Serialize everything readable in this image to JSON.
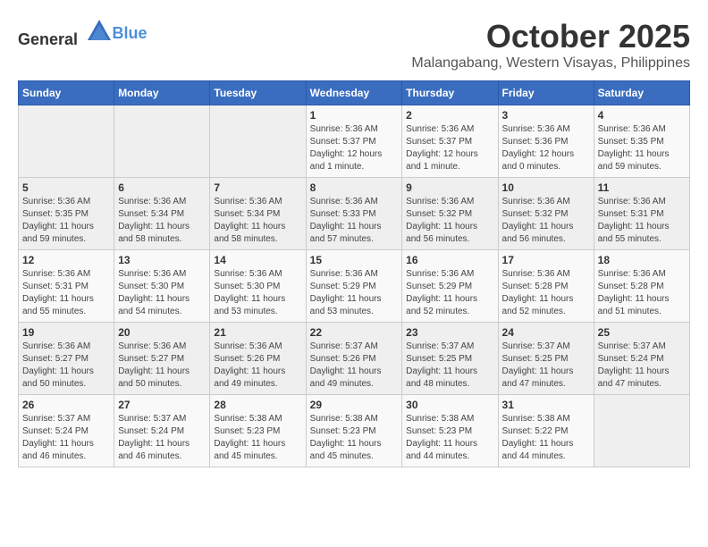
{
  "header": {
    "logo_general": "General",
    "logo_blue": "Blue",
    "month_title": "October 2025",
    "location": "Malangabang, Western Visayas, Philippines"
  },
  "weekdays": [
    "Sunday",
    "Monday",
    "Tuesday",
    "Wednesday",
    "Thursday",
    "Friday",
    "Saturday"
  ],
  "weeks": [
    [
      {
        "day": "",
        "info": ""
      },
      {
        "day": "",
        "info": ""
      },
      {
        "day": "",
        "info": ""
      },
      {
        "day": "1",
        "info": "Sunrise: 5:36 AM\nSunset: 5:37 PM\nDaylight: 12 hours\nand 1 minute."
      },
      {
        "day": "2",
        "info": "Sunrise: 5:36 AM\nSunset: 5:37 PM\nDaylight: 12 hours\nand 1 minute."
      },
      {
        "day": "3",
        "info": "Sunrise: 5:36 AM\nSunset: 5:36 PM\nDaylight: 12 hours\nand 0 minutes."
      },
      {
        "day": "4",
        "info": "Sunrise: 5:36 AM\nSunset: 5:35 PM\nDaylight: 11 hours\nand 59 minutes."
      }
    ],
    [
      {
        "day": "5",
        "info": "Sunrise: 5:36 AM\nSunset: 5:35 PM\nDaylight: 11 hours\nand 59 minutes."
      },
      {
        "day": "6",
        "info": "Sunrise: 5:36 AM\nSunset: 5:34 PM\nDaylight: 11 hours\nand 58 minutes."
      },
      {
        "day": "7",
        "info": "Sunrise: 5:36 AM\nSunset: 5:34 PM\nDaylight: 11 hours\nand 58 minutes."
      },
      {
        "day": "8",
        "info": "Sunrise: 5:36 AM\nSunset: 5:33 PM\nDaylight: 11 hours\nand 57 minutes."
      },
      {
        "day": "9",
        "info": "Sunrise: 5:36 AM\nSunset: 5:32 PM\nDaylight: 11 hours\nand 56 minutes."
      },
      {
        "day": "10",
        "info": "Sunrise: 5:36 AM\nSunset: 5:32 PM\nDaylight: 11 hours\nand 56 minutes."
      },
      {
        "day": "11",
        "info": "Sunrise: 5:36 AM\nSunset: 5:31 PM\nDaylight: 11 hours\nand 55 minutes."
      }
    ],
    [
      {
        "day": "12",
        "info": "Sunrise: 5:36 AM\nSunset: 5:31 PM\nDaylight: 11 hours\nand 55 minutes."
      },
      {
        "day": "13",
        "info": "Sunrise: 5:36 AM\nSunset: 5:30 PM\nDaylight: 11 hours\nand 54 minutes."
      },
      {
        "day": "14",
        "info": "Sunrise: 5:36 AM\nSunset: 5:30 PM\nDaylight: 11 hours\nand 53 minutes."
      },
      {
        "day": "15",
        "info": "Sunrise: 5:36 AM\nSunset: 5:29 PM\nDaylight: 11 hours\nand 53 minutes."
      },
      {
        "day": "16",
        "info": "Sunrise: 5:36 AM\nSunset: 5:29 PM\nDaylight: 11 hours\nand 52 minutes."
      },
      {
        "day": "17",
        "info": "Sunrise: 5:36 AM\nSunset: 5:28 PM\nDaylight: 11 hours\nand 52 minutes."
      },
      {
        "day": "18",
        "info": "Sunrise: 5:36 AM\nSunset: 5:28 PM\nDaylight: 11 hours\nand 51 minutes."
      }
    ],
    [
      {
        "day": "19",
        "info": "Sunrise: 5:36 AM\nSunset: 5:27 PM\nDaylight: 11 hours\nand 50 minutes."
      },
      {
        "day": "20",
        "info": "Sunrise: 5:36 AM\nSunset: 5:27 PM\nDaylight: 11 hours\nand 50 minutes."
      },
      {
        "day": "21",
        "info": "Sunrise: 5:36 AM\nSunset: 5:26 PM\nDaylight: 11 hours\nand 49 minutes."
      },
      {
        "day": "22",
        "info": "Sunrise: 5:37 AM\nSunset: 5:26 PM\nDaylight: 11 hours\nand 49 minutes."
      },
      {
        "day": "23",
        "info": "Sunrise: 5:37 AM\nSunset: 5:25 PM\nDaylight: 11 hours\nand 48 minutes."
      },
      {
        "day": "24",
        "info": "Sunrise: 5:37 AM\nSunset: 5:25 PM\nDaylight: 11 hours\nand 47 minutes."
      },
      {
        "day": "25",
        "info": "Sunrise: 5:37 AM\nSunset: 5:24 PM\nDaylight: 11 hours\nand 47 minutes."
      }
    ],
    [
      {
        "day": "26",
        "info": "Sunrise: 5:37 AM\nSunset: 5:24 PM\nDaylight: 11 hours\nand 46 minutes."
      },
      {
        "day": "27",
        "info": "Sunrise: 5:37 AM\nSunset: 5:24 PM\nDaylight: 11 hours\nand 46 minutes."
      },
      {
        "day": "28",
        "info": "Sunrise: 5:38 AM\nSunset: 5:23 PM\nDaylight: 11 hours\nand 45 minutes."
      },
      {
        "day": "29",
        "info": "Sunrise: 5:38 AM\nSunset: 5:23 PM\nDaylight: 11 hours\nand 45 minutes."
      },
      {
        "day": "30",
        "info": "Sunrise: 5:38 AM\nSunset: 5:23 PM\nDaylight: 11 hours\nand 44 minutes."
      },
      {
        "day": "31",
        "info": "Sunrise: 5:38 AM\nSunset: 5:22 PM\nDaylight: 11 hours\nand 44 minutes."
      },
      {
        "day": "",
        "info": ""
      }
    ]
  ]
}
